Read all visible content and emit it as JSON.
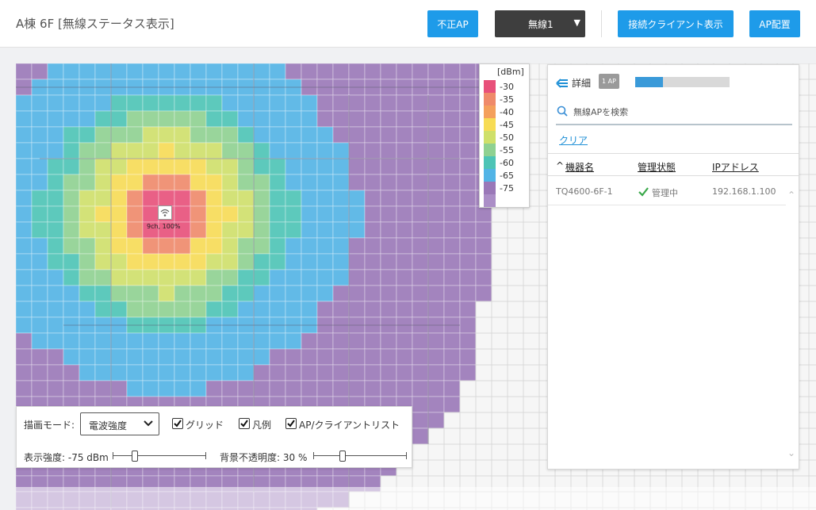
{
  "header": {
    "title": "A棟 6F [無線ステータス表示]",
    "rogue_ap_label": "不正AP",
    "wireless_select_value": "無線1",
    "connected_clients_label": "接続クライアント表示",
    "ap_placement_label": "AP配置"
  },
  "legend": {
    "unit": "[dBm]",
    "items": [
      {
        "label": "-30",
        "color": "#e8507a"
      },
      {
        "label": "-35",
        "color": "#ef8a6a"
      },
      {
        "label": "-40",
        "color": "#f4a05c"
      },
      {
        "label": "-45",
        "color": "#f7dc55"
      },
      {
        "label": "-50",
        "color": "#cfe06a"
      },
      {
        "label": "-55",
        "color": "#8fd191"
      },
      {
        "label": "-60",
        "color": "#4dc4b6"
      },
      {
        "label": "-65",
        "color": "#52b4e6"
      },
      {
        "label": "-75",
        "color": "#9a78b8"
      },
      {
        "label": "",
        "color": "#ab8ec7"
      }
    ]
  },
  "map": {
    "ap_label": "9ch, 100%",
    "ap_icon": "wifi-icon"
  },
  "controls": {
    "draw_mode_label": "描画モード:",
    "draw_mode_value": "電波強度",
    "grid_label": "グリッド",
    "grid_checked": true,
    "legend_label": "凡例",
    "legend_checked": true,
    "aplist_label": "AP/クライアントリスト",
    "aplist_checked": true,
    "strength_label": "表示強度: -75 dBm",
    "strength_fraction": 0.22,
    "opacity_label": "背景不透明度: 30 %",
    "opacity_fraction": 0.3
  },
  "panel": {
    "detail_label": "詳細",
    "ap_count_badge": "1 AP",
    "progress_fraction": 0.29,
    "search_placeholder": "無線APを検索",
    "clear_label": "クリア",
    "columns": [
      "機器名",
      "管理状態",
      "IPアドレス"
    ],
    "sort_indicator": "^",
    "rows": [
      {
        "name": "TQ4600-6F-1",
        "status": "管理中",
        "ip": "192.168.1.100"
      }
    ]
  }
}
